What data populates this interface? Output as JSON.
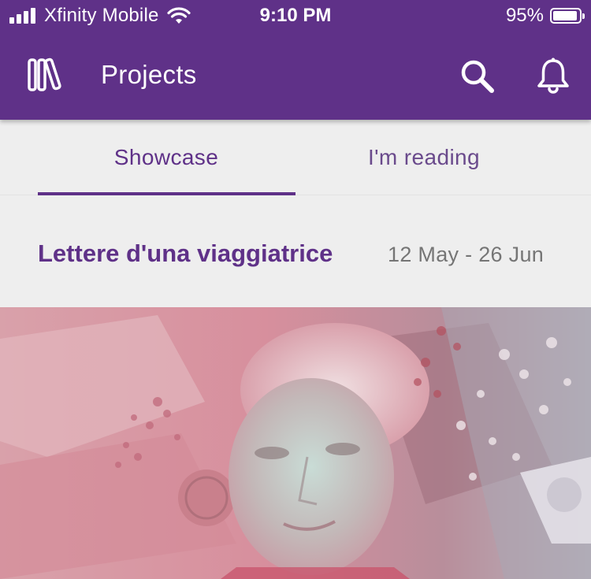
{
  "status_bar": {
    "carrier": "Xfinity Mobile",
    "time": "9:10 PM",
    "battery_percent": "95%",
    "battery_level": 0.95,
    "signal_bars": 4,
    "icons": [
      "signal-bars-icon",
      "wifi-icon",
      "battery-icon"
    ]
  },
  "app_bar": {
    "title": "Projects",
    "icons": [
      "library-icon",
      "search-icon",
      "bell-icon"
    ]
  },
  "tabs": [
    {
      "label": "Showcase",
      "selected": true
    },
    {
      "label": "I'm reading",
      "selected": false
    }
  ],
  "project": {
    "title": "Lettere d'una viaggiatrice",
    "dates": "12 May - 26 Jun"
  },
  "colors": {
    "brand_purple": "#5f3188",
    "background": "#eeeeee",
    "date_gray": "#757575",
    "cover_pink": "#d98c9c"
  }
}
